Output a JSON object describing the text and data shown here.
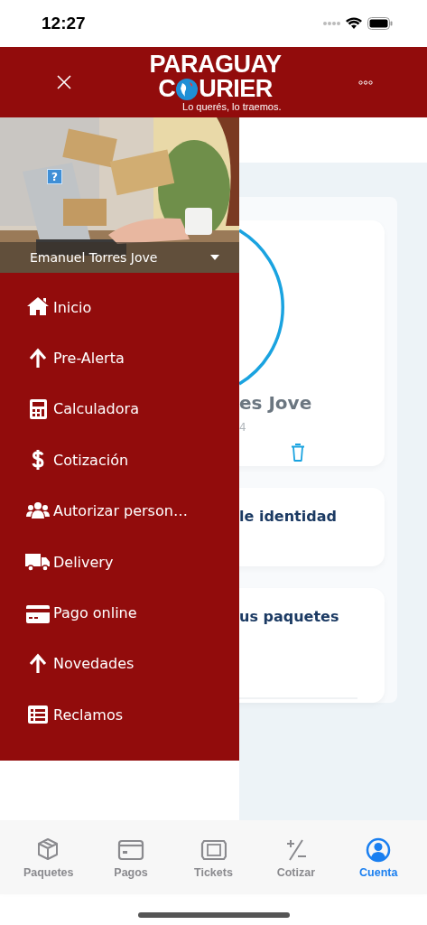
{
  "status_bar": {
    "time": "12:27"
  },
  "header": {
    "logo": {
      "line_1": "PARAGUAY",
      "line_2_start": "C",
      "line_2_end": "URIER",
      "tagline": "Lo querés, lo traemos."
    }
  },
  "background_page": {
    "profile_name": "es Jove",
    "profile_detail": "4",
    "identity_card_title": "le identidad",
    "packages_card_title": "us paquetes"
  },
  "drawer": {
    "photo": {
      "kind": "picture",
      "broken_image_mark": "?"
    },
    "user_name": "Emanuel Torres Jove",
    "items": [
      {
        "label": "Inicio"
      },
      {
        "label": "Pre-Alerta"
      },
      {
        "label": "Calculadora"
      },
      {
        "label": "Cotización"
      },
      {
        "label": "Autorizar person…"
      },
      {
        "label": "Delivery"
      },
      {
        "label": "Pago online"
      },
      {
        "label": "Novedades"
      },
      {
        "label": "Reclamos"
      }
    ]
  },
  "tab_bar": [
    {
      "label": "Paquetes",
      "selected": false
    },
    {
      "label": "Pagos",
      "selected": false
    },
    {
      "label": "Tickets",
      "selected": false
    },
    {
      "label": "Cotizar",
      "selected": false
    },
    {
      "label": "Cuenta",
      "selected": true
    }
  ]
}
